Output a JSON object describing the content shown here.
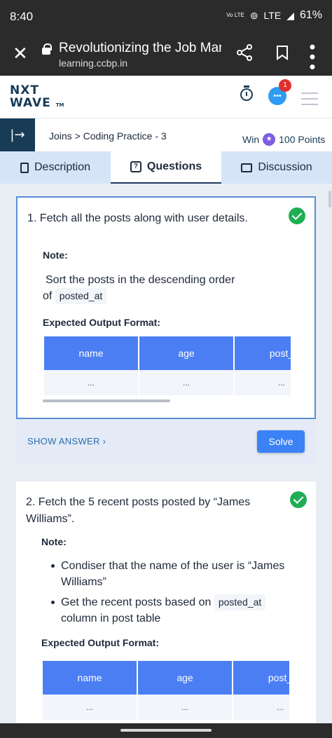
{
  "status_bar": {
    "time": "8:40",
    "volte": "Vo LTE",
    "lte": "LTE",
    "battery": "61%"
  },
  "browser": {
    "title": "Revolutionizing the Job Mar...",
    "domain": "learning.ccbp.in"
  },
  "app": {
    "logo_line1": "NXT",
    "logo_line2": "WAVE",
    "logo_tm": "TM",
    "notification_count": "1"
  },
  "course_bar": {
    "breadcrumb": "Joins > Coding Practice - 3",
    "win_label": "Win",
    "points": "100 Points"
  },
  "tabs": [
    {
      "label": "Description"
    },
    {
      "label": "Questions"
    },
    {
      "label": "Discussion"
    }
  ],
  "questions": [
    {
      "title": "1. Fetch all the posts along with user details.",
      "note_label": "Note:",
      "note_text": "Sort the posts in the descending order",
      "note_text_of": "of",
      "note_code": "posted_at",
      "expected_label": "Expected Output Format:",
      "columns": [
        "name",
        "age",
        "post_"
      ],
      "row": [
        "...",
        "...",
        "..."
      ],
      "show_answer": "SHOW ANSWER",
      "solve": "Solve"
    },
    {
      "title": "2. Fetch the 5 recent posts posted by “James Williams”.",
      "note_label": "Note:",
      "bullet1": "Condiser that the name of the user is “James Williams”",
      "bullet2_pre": "Get the recent posts based on",
      "bullet2_code": "posted_at",
      "bullet2_post": "column in post table",
      "expected_label": "Expected Output Format:",
      "columns": [
        "name",
        "age",
        "post_"
      ],
      "row": [
        "...",
        "...",
        "..."
      ]
    }
  ]
}
